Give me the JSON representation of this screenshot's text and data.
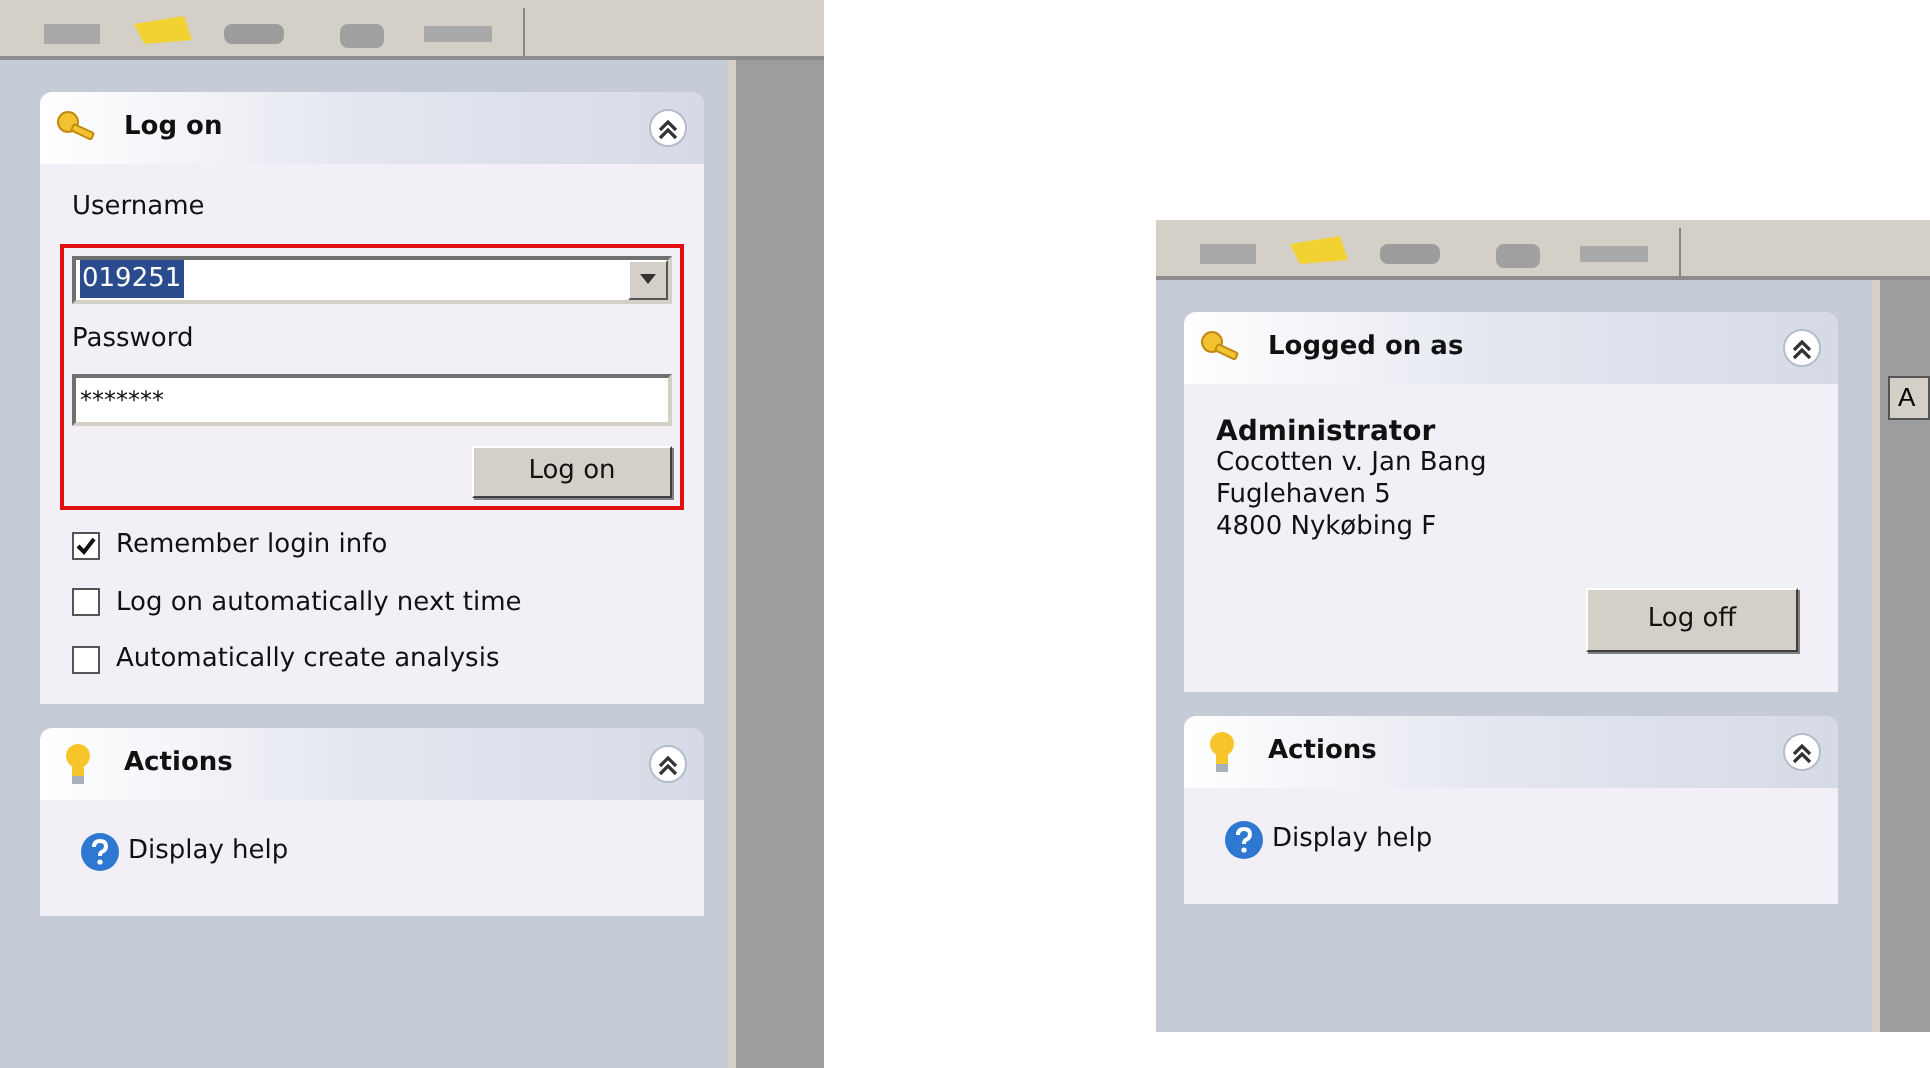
{
  "panels": [
    {
      "cards": [
        {
          "kind": "login",
          "title": "Log on",
          "expanded": true,
          "highlighted": true,
          "username_label": "Username",
          "username": "019251",
          "username_selected": true,
          "password_label": "Password",
          "password": "*******",
          "button": "Log on",
          "options": [
            {
              "label": "Remember login info",
              "checked": true
            },
            {
              "label": "Log on automatically next time",
              "checked": false
            },
            {
              "label": "Automatically create analysis",
              "checked": false
            }
          ]
        },
        {
          "kind": "actions",
          "title": "Actions",
          "expanded": true,
          "items": [
            "Display help"
          ]
        }
      ]
    },
    {
      "tab_label": "A",
      "cards": [
        {
          "kind": "user",
          "title": "Logged on as",
          "expanded": true,
          "name": "Administrator",
          "lines": [
            "Cocotten v. Jan Bang",
            "Fuglehaven 5",
            "4800 Nykøbing F"
          ],
          "button": "Log off"
        },
        {
          "kind": "actions",
          "title": "Actions",
          "expanded": true,
          "items": [
            "Display help"
          ]
        }
      ]
    }
  ]
}
